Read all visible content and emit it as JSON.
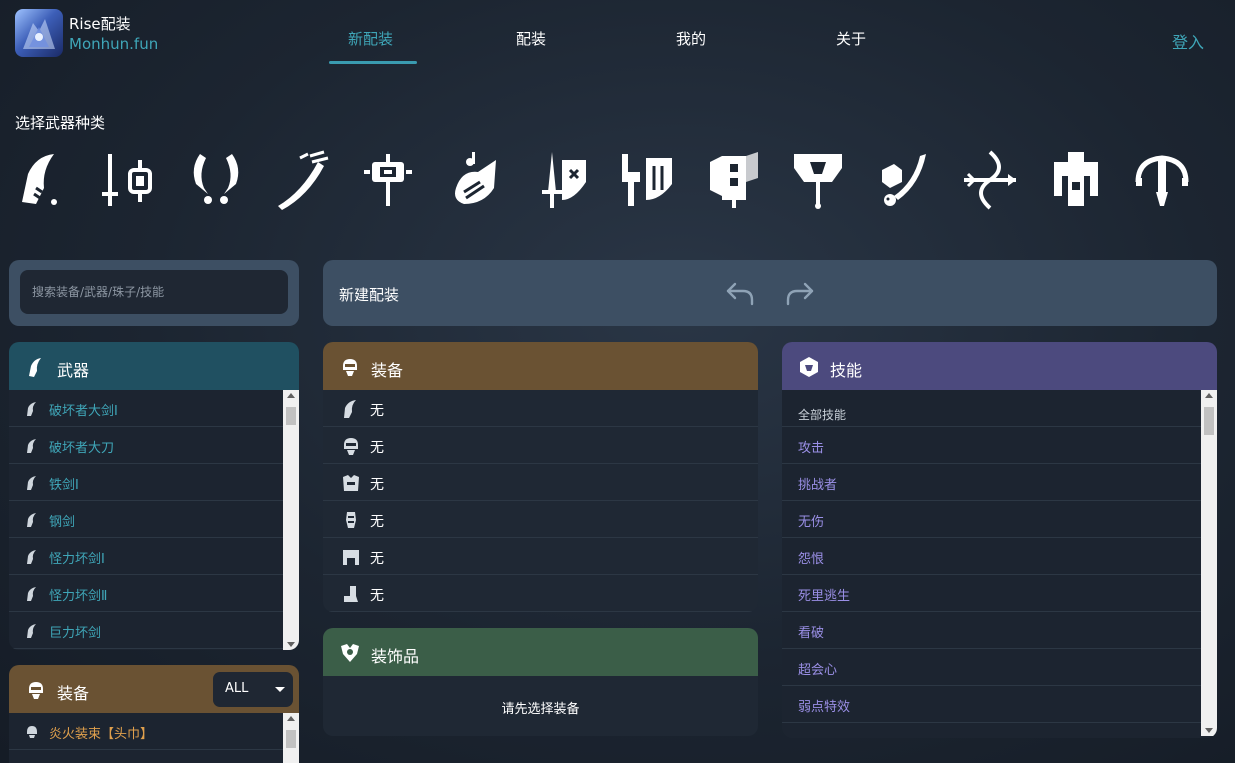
{
  "app": {
    "title": "Rise配装",
    "subtitle": "Monhun.fun"
  },
  "nav": {
    "items": [
      "新配装",
      "配装",
      "我的",
      "关于"
    ],
    "active": "新配装",
    "login": "登入"
  },
  "weapon_select": {
    "label": "选择武器种类",
    "weapons": [
      {
        "icon": "great-sword-icon"
      },
      {
        "icon": "sword-and-shield-icon"
      },
      {
        "icon": "dual-blades-icon"
      },
      {
        "icon": "long-sword-icon"
      },
      {
        "icon": "hammer-icon"
      },
      {
        "icon": "hunting-horn-icon"
      },
      {
        "icon": "lance-icon"
      },
      {
        "icon": "gunlance-icon"
      },
      {
        "icon": "switch-axe-icon"
      },
      {
        "icon": "charge-blade-icon"
      },
      {
        "icon": "insect-glaive-icon"
      },
      {
        "icon": "bow-icon"
      },
      {
        "icon": "heavy-bowgun-icon"
      },
      {
        "icon": "light-bowgun-icon"
      }
    ]
  },
  "search": {
    "placeholder": "搜索装备/武器/珠子/技能"
  },
  "build": {
    "title": "新建配装"
  },
  "weapon_panel": {
    "title": "武器",
    "items": [
      "破坏者大剑Ⅰ",
      "破坏者大刀",
      "铁剑Ⅰ",
      "钢剑",
      "怪力坏剑Ⅰ",
      "怪力坏剑Ⅱ",
      "巨力坏剑"
    ]
  },
  "equip_panel": {
    "title": "装备",
    "filter": "ALL",
    "items": [
      "炎火装束【头巾】"
    ]
  },
  "gear_panel": {
    "title": "装备",
    "slots": [
      {
        "icon": "weapon-slot-icon",
        "value": "无"
      },
      {
        "icon": "helm-slot-icon",
        "value": "无"
      },
      {
        "icon": "chest-slot-icon",
        "value": "无"
      },
      {
        "icon": "arm-slot-icon",
        "value": "无"
      },
      {
        "icon": "waist-slot-icon",
        "value": "无"
      },
      {
        "icon": "leg-slot-icon",
        "value": "无"
      }
    ]
  },
  "deco_panel": {
    "title": "装饰品",
    "hint": "请先选择装备"
  },
  "skill_panel": {
    "title": "技能",
    "header": "全部技能",
    "items": [
      "攻击",
      "挑战者",
      "无伤",
      "怨恨",
      "死里逃生",
      "看破",
      "超会心",
      "弱点特效"
    ]
  }
}
